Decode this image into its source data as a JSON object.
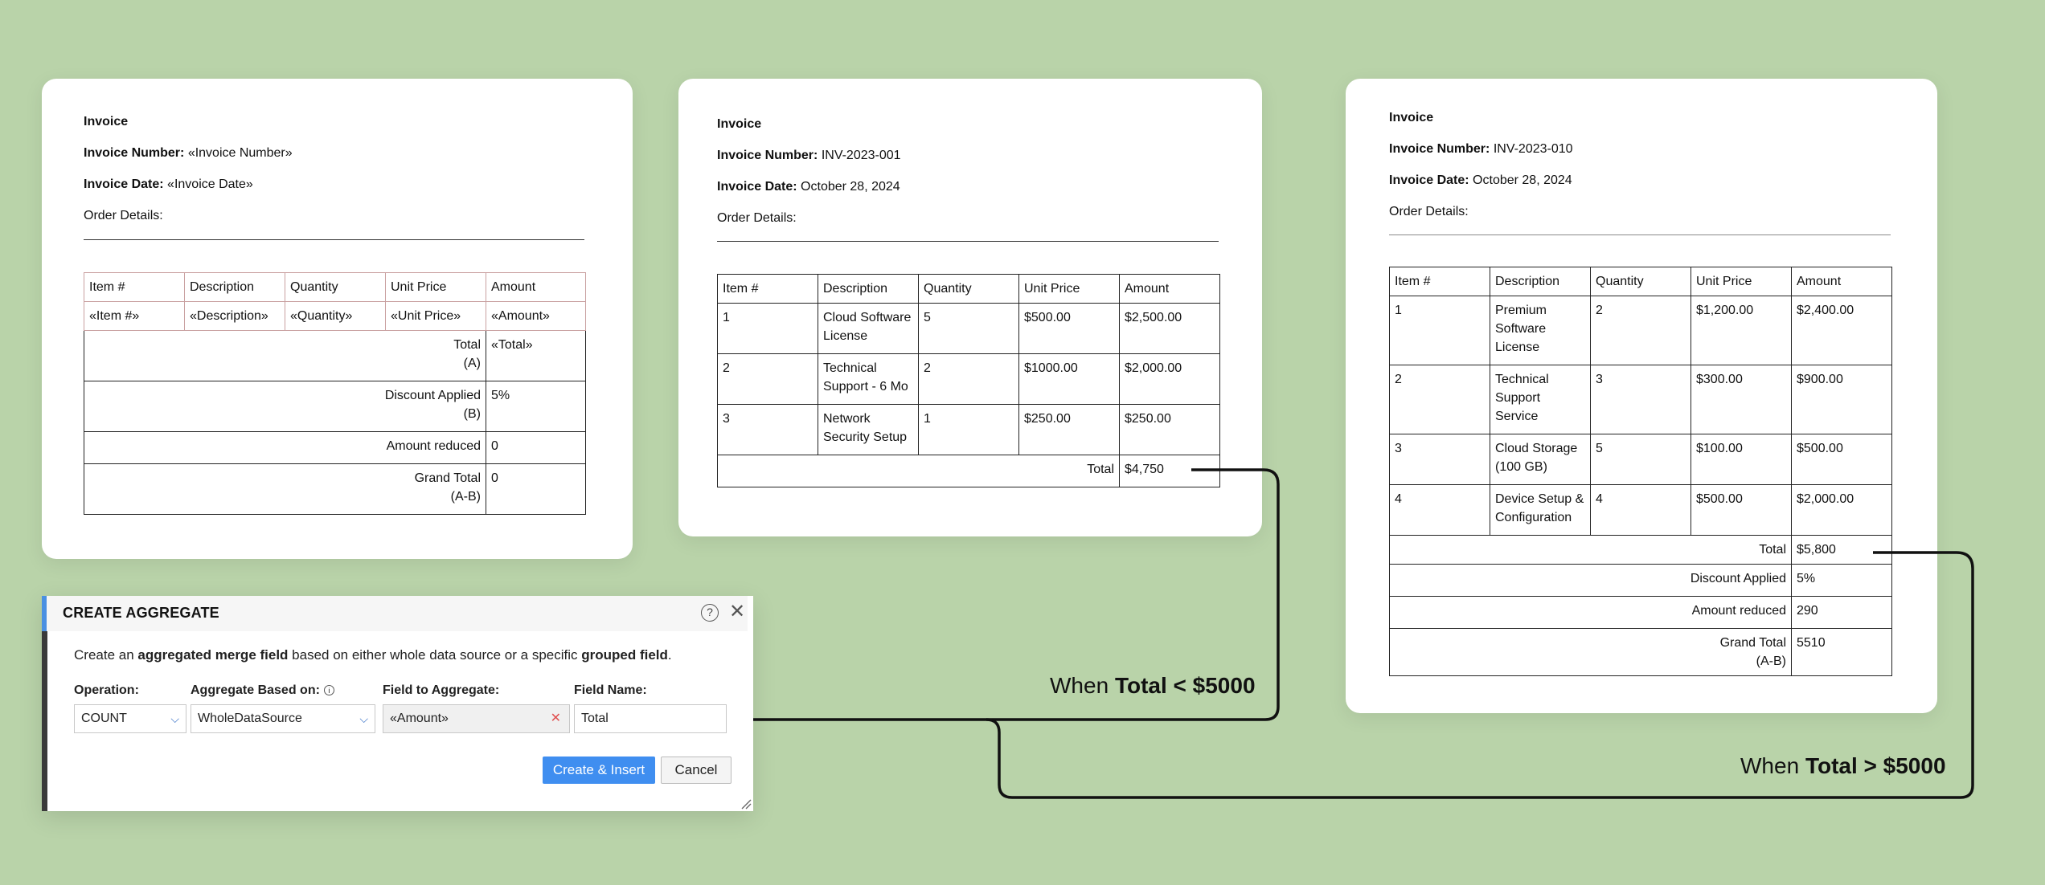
{
  "template_card": {
    "title": "Invoice",
    "number_label": "Invoice Number:",
    "number_value": "«Invoice Number»",
    "date_label": "Invoice Date:",
    "date_value": "«Invoice Date»",
    "order_details": "Order Details:",
    "headers": [
      "Item #",
      "Description",
      "Quantity",
      "Unit Price",
      "Amount"
    ],
    "row": [
      "«Item #»",
      "«Description»",
      "«Quantity»",
      "«Unit Price»",
      "«Amount»"
    ],
    "summary": [
      {
        "label": "Total (A)",
        "label_l1": "Total",
        "label_l2": "(A)",
        "value": "«Total»"
      },
      {
        "label": "Discount Applied (B)",
        "label_l1": "Discount Applied",
        "label_l2": "(B)",
        "value": "5%"
      },
      {
        "label": "Amount reduced",
        "label_l1": "Amount reduced",
        "label_l2": "",
        "value": "0"
      },
      {
        "label": "Grand Total (A-B)",
        "label_l1": "Grand Total",
        "label_l2": "(A-B)",
        "value": "0"
      }
    ]
  },
  "invoice_low": {
    "title": "Invoice",
    "number_label": "Invoice Number:",
    "number_value": "INV-2023-001",
    "date_label": "Invoice Date:",
    "date_value": "October 28, 2024",
    "order_details": "Order Details:",
    "headers": [
      "Item #",
      "Description",
      "Quantity",
      "Unit Price",
      "Amount"
    ],
    "rows": [
      {
        "item": "1",
        "desc_l1": "Cloud Software",
        "desc_l2": "License",
        "qty": "5",
        "price": "$500.00",
        "amount": "$2,500.00"
      },
      {
        "item": "2",
        "desc_l1": "Technical",
        "desc_l2": "Support - 6 Mo",
        "qty": "2",
        "price": "$1000.00",
        "amount": "$2,000.00"
      },
      {
        "item": "3",
        "desc_l1": "Network",
        "desc_l2": "Security Setup",
        "qty": "1",
        "price": "$250.00",
        "amount": "$250.00"
      }
    ],
    "total_label": "Total",
    "total_value": "$4,750"
  },
  "invoice_high": {
    "title": "Invoice",
    "number_label": "Invoice Number:",
    "number_value": "INV-2023-010",
    "date_label": "Invoice Date:",
    "date_value": "October 28, 2024",
    "order_details": "Order Details:",
    "headers": [
      "Item #",
      "Description",
      "Quantity",
      "Unit Price",
      "Amount"
    ],
    "rows": [
      {
        "item": "1",
        "desc_l1": "Premium",
        "desc_l2": "Software",
        "desc_l3": "License",
        "qty": "2",
        "price": "$1,200.00",
        "amount": "$2,400.00"
      },
      {
        "item": "2",
        "desc_l1": "Technical",
        "desc_l2": "Support",
        "desc_l3": "Service",
        "qty": "3",
        "price": "$300.00",
        "amount": "$900.00"
      },
      {
        "item": "3",
        "desc_l1": "Cloud Storage",
        "desc_l2": "(100 GB)",
        "desc_l3": "",
        "qty": "5",
        "price": "$100.00",
        "amount": "$500.00"
      },
      {
        "item": "4",
        "desc_l1": "Device Setup &",
        "desc_l2": "Configuration",
        "desc_l3": "",
        "qty": "4",
        "price": "$500.00",
        "amount": "$2,000.00"
      }
    ],
    "summary": [
      {
        "label_l1": "Total",
        "label_l2": "",
        "value": "$5,800"
      },
      {
        "label_l1": "Discount Applied",
        "label_l2": "",
        "value": "5%"
      },
      {
        "label_l1": "Amount reduced",
        "label_l2": "",
        "value": "290"
      },
      {
        "label_l1": "Grand Total",
        "label_l2": "(A-B)",
        "value": "5510"
      }
    ]
  },
  "dialog": {
    "title": "CREATE AGGREGATE",
    "help_icon": "help-circle-icon",
    "close_icon": "close-icon",
    "desc_pre": "Create an ",
    "desc_bold1": "aggregated merge field",
    "desc_mid": " based on either whole data source or a specific ",
    "desc_bold2": "grouped field",
    "desc_end": ".",
    "operation_label": "Operation:",
    "operation_value": "COUNT",
    "based_on_label": "Aggregate Based on:",
    "based_on_value": "WholeDataSource",
    "field_label": "Field to Aggregate:",
    "field_value": "«Amount»",
    "name_label": "Field Name:",
    "name_value": "Total",
    "create_button": "Create & Insert",
    "cancel_button": "Cancel"
  },
  "conditions": {
    "low_prefix": "When ",
    "low_bold": "Total < $5000",
    "high_prefix": "When ",
    "high_bold": "Total > $5000"
  },
  "colors": {
    "background": "#b9d3a9",
    "primary_button": "#3f8ef0",
    "accent_bar": "#4a90e2"
  }
}
